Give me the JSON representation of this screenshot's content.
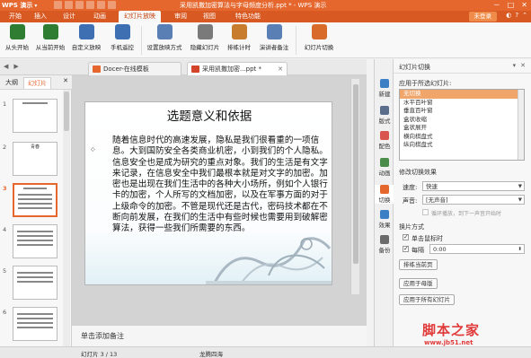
{
  "app": {
    "logo": "WPS 演示",
    "window_title": "采用凯撒加密算法与字母频度分析.ppt * - WPS 演示",
    "window_controls": [
      "－",
      "□",
      "✕"
    ]
  },
  "menu": {
    "items": [
      "开始",
      "插入",
      "设计",
      "动画",
      "幻灯片放映",
      "审阅",
      "视图",
      "特色功能"
    ],
    "active": "幻灯片放映",
    "login": "未登录"
  },
  "ribbon": {
    "buttons": [
      {
        "label": "从头开始",
        "color": "#2e7d32"
      },
      {
        "label": "从当前开始",
        "color": "#2e7d32"
      },
      {
        "label": "自定义放映",
        "color": "#3e6fb3"
      },
      {
        "label": "手机遥控",
        "color": "#3e6fb3"
      },
      {
        "label": "设置放映方式",
        "color": "#5a7fb5"
      },
      {
        "label": "隐藏幻灯片",
        "color": "#7a7a7a"
      },
      {
        "label": "排练计时",
        "color": "#c77c2e"
      },
      {
        "label": "演讲者备注",
        "color": "#5a7fb5"
      },
      {
        "label": "幻灯片切换",
        "color": "#d86a2a"
      }
    ]
  },
  "tabs": [
    {
      "label": "Docer-在线模板",
      "color": "#e5672d"
    },
    {
      "label": "采用凯撒加密...ppt *",
      "color": "#d2452b"
    }
  ],
  "left_pane": {
    "tabs": [
      "大纲",
      "幻灯片"
    ],
    "active": "幻灯片",
    "slide_numbers": [
      "1",
      "2",
      "3",
      "4",
      "5",
      "6"
    ],
    "slide2_title": "青春"
  },
  "slide": {
    "title": "选题意义和依据",
    "bullet": "◇",
    "body": "随着信息时代的高速发展，隐私是我们很看重的一项信息。大到国防安全各类商业机密，小到我们的个人隐私。信息安全也是成为研究的重点对象。我们的生活是有文字来记录，在信息安全中我们最根本就是对文字的加密。加密也是出现在我们生活中的各种大小场所，例如个人银行卡的加密，个人所写的文档加密，以及在军事方面的对于上级命令的加密。不管是现代还是古代，密码技术都在不断向前发展，在我们的生活中有些时候也需要用到破解密算法，获得一些我们所需要的东西。"
  },
  "notes": {
    "placeholder": "单击添加备注"
  },
  "status": {
    "slide_counter": "幻灯片 3 / 13",
    "theme": "龙腾四海"
  },
  "side_icons": [
    {
      "label": "新建",
      "color": "#3c7fc4"
    },
    {
      "label": "版式",
      "color": "#5a6e8c"
    },
    {
      "label": "配色",
      "color": "#d9534f"
    },
    {
      "label": "动画",
      "color": "#4c8c4a"
    },
    {
      "label": "切换",
      "color": "#e5672d"
    },
    {
      "label": "效果",
      "color": "#3c7fc4"
    },
    {
      "label": "备份",
      "color": "#6a6a6a"
    }
  ],
  "task_pane": {
    "title": "幻灯片切换",
    "apply_to_label": "应用于所选幻灯片:",
    "effects": [
      "无切换",
      "水平百叶窗",
      "垂直百叶窗",
      "盒状收缩",
      "盒状展开",
      "横向棋盘式",
      "纵向棋盘式"
    ],
    "selected_effect": "无切换",
    "modify_label": "修改切换效果",
    "speed_label": "速度:",
    "speed_value": "快速",
    "sound_label": "声音:",
    "sound_value": "[无声音]",
    "loop_label": "循环播放，到下一声音开始时",
    "advance_label": "换片方式",
    "on_click_label": "单击鼠标时",
    "every_label": "每隔",
    "every_value": "0:00",
    "rehearse_button": "排练当前页",
    "apply_master_button": "应用于母版",
    "apply_all_button": "应用于所有幻灯片"
  },
  "watermark": {
    "brand": "脚本之家",
    "url": "www.jb51.net"
  }
}
